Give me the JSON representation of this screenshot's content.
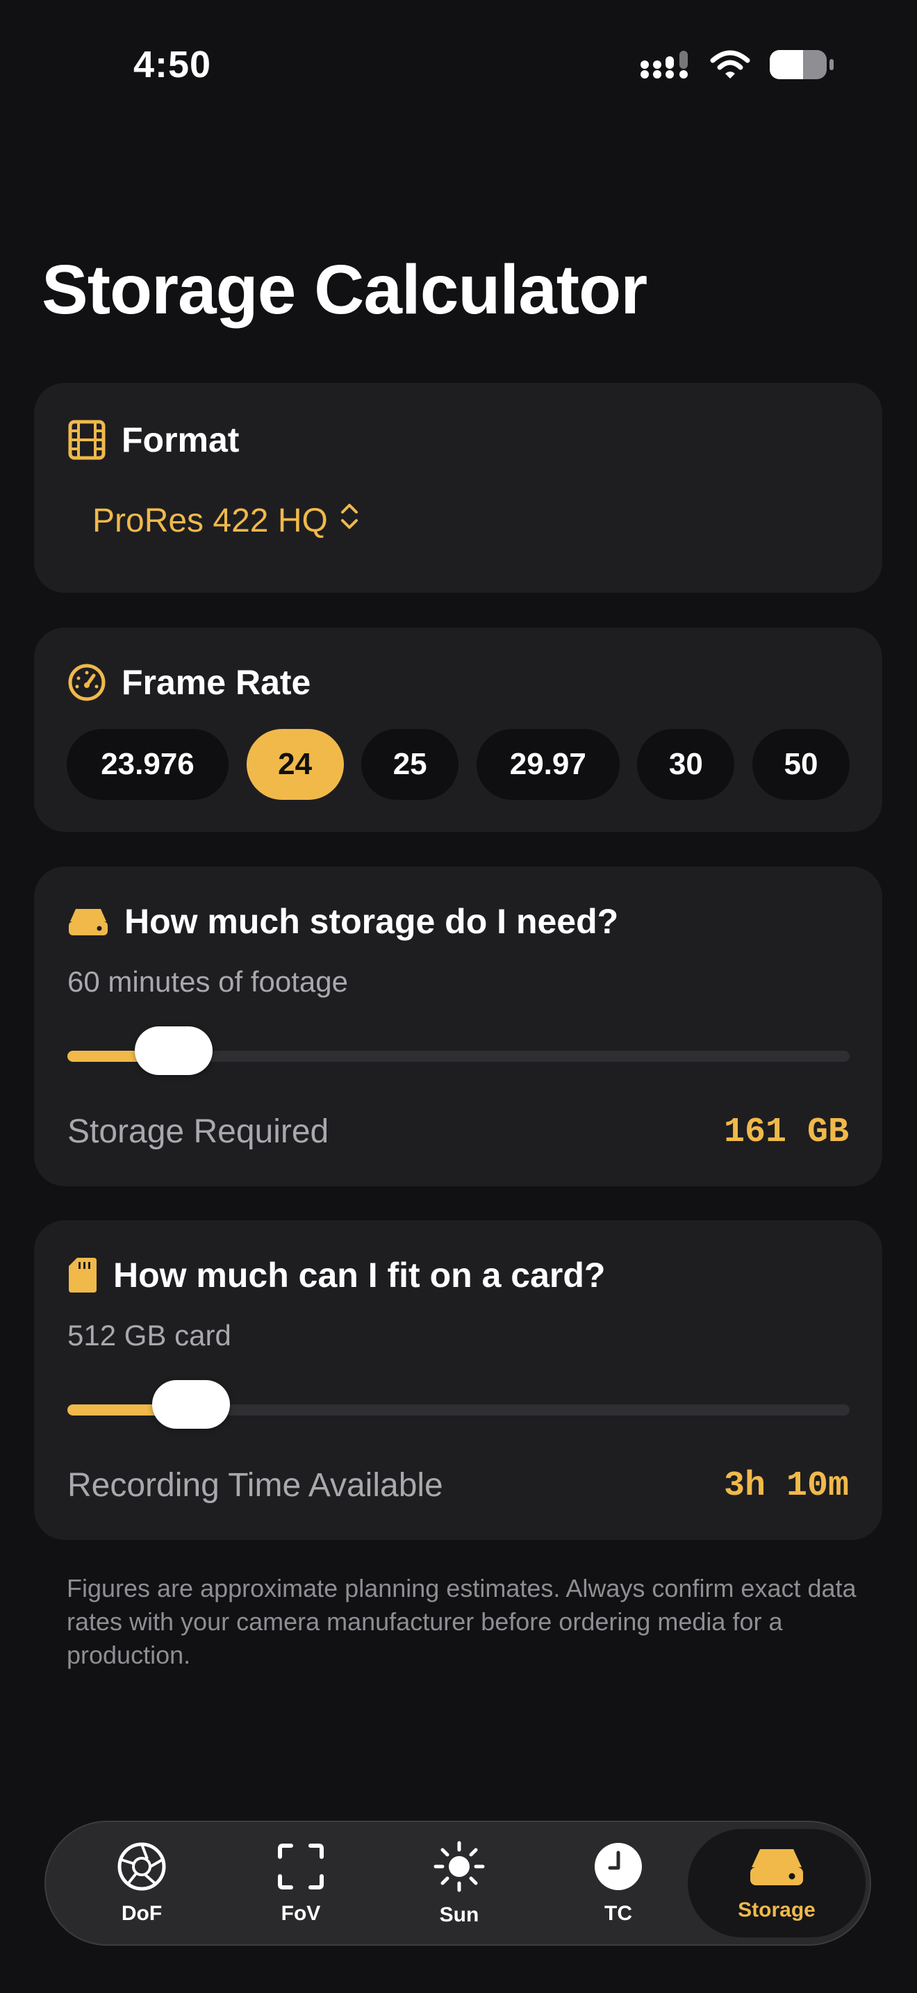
{
  "status": {
    "time": "4:50"
  },
  "page": {
    "title": "Storage Calculator"
  },
  "format": {
    "title": "Format",
    "value": "ProRes 422 HQ"
  },
  "frame_rate": {
    "title": "Frame Rate",
    "options": [
      "23.976",
      "24",
      "25",
      "29.97",
      "30",
      "50"
    ],
    "selected": "24"
  },
  "storage_need": {
    "title": "How much storage do I need?",
    "subtitle": "60 minutes of footage",
    "slider_fraction": 0.136,
    "result_label": "Storage Required",
    "result_value": "161 GB"
  },
  "card_fit": {
    "title": "How much can I fit on a card?",
    "subtitle": "512 GB card",
    "slider_fraction": 0.158,
    "result_label": "Recording Time Available",
    "result_value": "3h 10m"
  },
  "disclaimer": "Figures are approximate planning estimates. Always confirm exact data rates with your camera manufacturer before ordering media for a production.",
  "tabs": [
    {
      "label": "DoF",
      "icon": "aperture-icon"
    },
    {
      "label": "FoV",
      "icon": "viewfinder-icon"
    },
    {
      "label": "Sun",
      "icon": "sun-icon"
    },
    {
      "label": "TC",
      "icon": "clock-icon"
    },
    {
      "label": "Storage",
      "icon": "storage-drive-icon",
      "active": true
    }
  ],
  "colors": {
    "accent": "#f0b94a",
    "background": "#111113",
    "card": "#1e1e21"
  }
}
